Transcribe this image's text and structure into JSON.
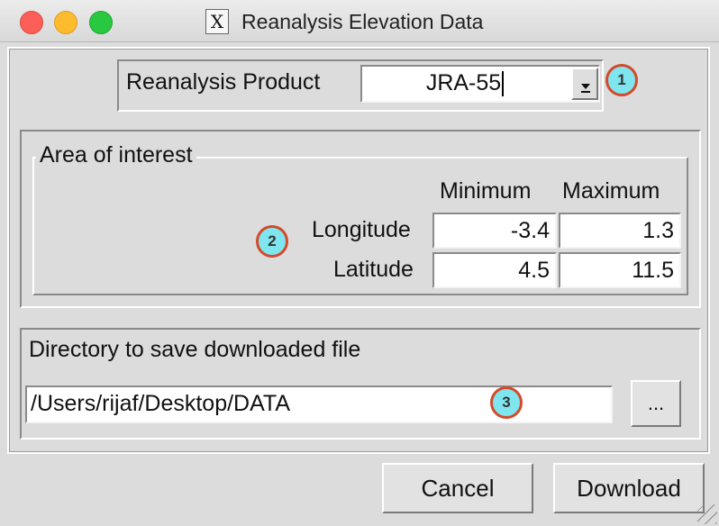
{
  "window": {
    "title": "Reanalysis Elevation Data",
    "app_icon": "x11-icon"
  },
  "product": {
    "label": "Reanalysis Product",
    "value": "JRA-55",
    "badge": "1"
  },
  "area": {
    "legend": "Area of interest",
    "col_min": "Minimum",
    "col_max": "Maximum",
    "rows": [
      {
        "label": "Longitude",
        "min": "-3.4",
        "max": "1.3"
      },
      {
        "label": "Latitude",
        "min": "4.5",
        "max": "11.5"
      }
    ],
    "badge": "2"
  },
  "directory": {
    "label": "Directory to save downloaded file",
    "value": "/Users/rijaf/Desktop/DATA",
    "browse_label": "...",
    "badge": "3"
  },
  "buttons": {
    "cancel": "Cancel",
    "download": "Download"
  },
  "colors": {
    "badge_fill": "#7fe6ef",
    "badge_ring": "#d44a2a"
  }
}
